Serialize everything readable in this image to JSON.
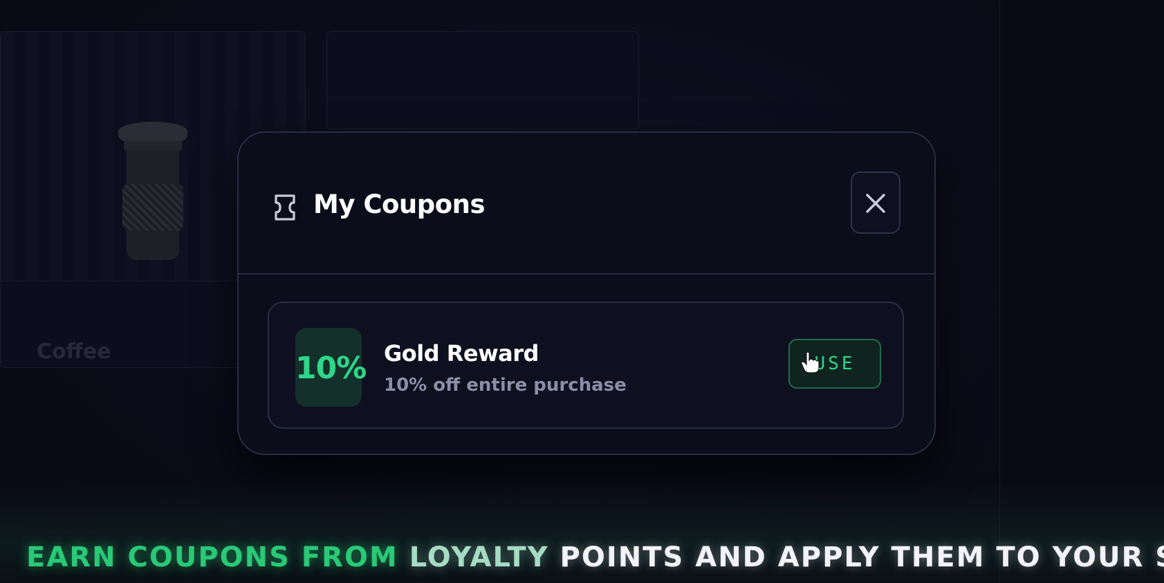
{
  "background": {
    "card_coffee_name": "Coffee"
  },
  "modal": {
    "title": "My Coupons",
    "close_icon": "close-icon",
    "coupon_icon": "ticket-icon"
  },
  "coupons": [
    {
      "badge": "10%",
      "title": "Gold Reward",
      "description": "10% off entire purchase",
      "action_label": "USE"
    }
  ],
  "caption": {
    "part1": "EARN COUPONS FROM",
    "part2": "LOYALTY",
    "part3": "POINTS AND APPLY THEM TO YOUR SHOPPING CART"
  },
  "colors": {
    "accent": "#2ed68a",
    "modal_bg": "#0c0d1b",
    "page_bg": "#0b0c1a"
  }
}
